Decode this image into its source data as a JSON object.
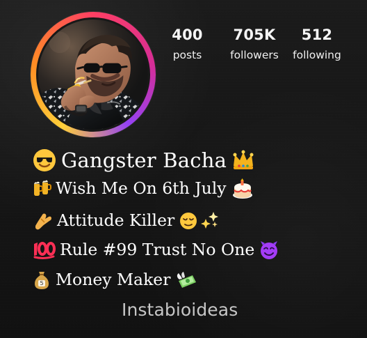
{
  "profile": {
    "stats": [
      {
        "value": "400",
        "label": "posts"
      },
      {
        "value": "705K",
        "label": "followers"
      },
      {
        "value": "512",
        "label": "following"
      }
    ],
    "bio": [
      {
        "text": "Gangster Bacha"
      },
      {
        "text": "Wish Me On 6th July"
      },
      {
        "text": "Attitude Killer"
      },
      {
        "text": "Rule #99 Trust No One"
      },
      {
        "text": "Money Maker"
      }
    ],
    "watermark": "Instabioideas"
  },
  "icons": {
    "sunglasses": "sunglasses-emoji-icon",
    "crown": "crown-emoji-icon",
    "beer": "beer-mugs-emoji-icon",
    "cake": "birthday-cake-emoji-icon",
    "hand": "hand-emoji-icon",
    "relieved": "relieved-face-emoji-icon",
    "sparkles": "sparkles-emoji-icon",
    "hundred": "hundred-points-emoji-icon",
    "devil": "smiling-devil-emoji-icon",
    "money_bag": "money-bag-emoji-icon",
    "money_wings": "money-with-wings-emoji-icon"
  },
  "colors": {
    "background": "#141414",
    "text": "#ffffff",
    "ring_start": "#ffcf3a",
    "ring_mid": "#ff3f63",
    "ring_end": "#9542f4",
    "watermark": "#d6d6d6"
  }
}
